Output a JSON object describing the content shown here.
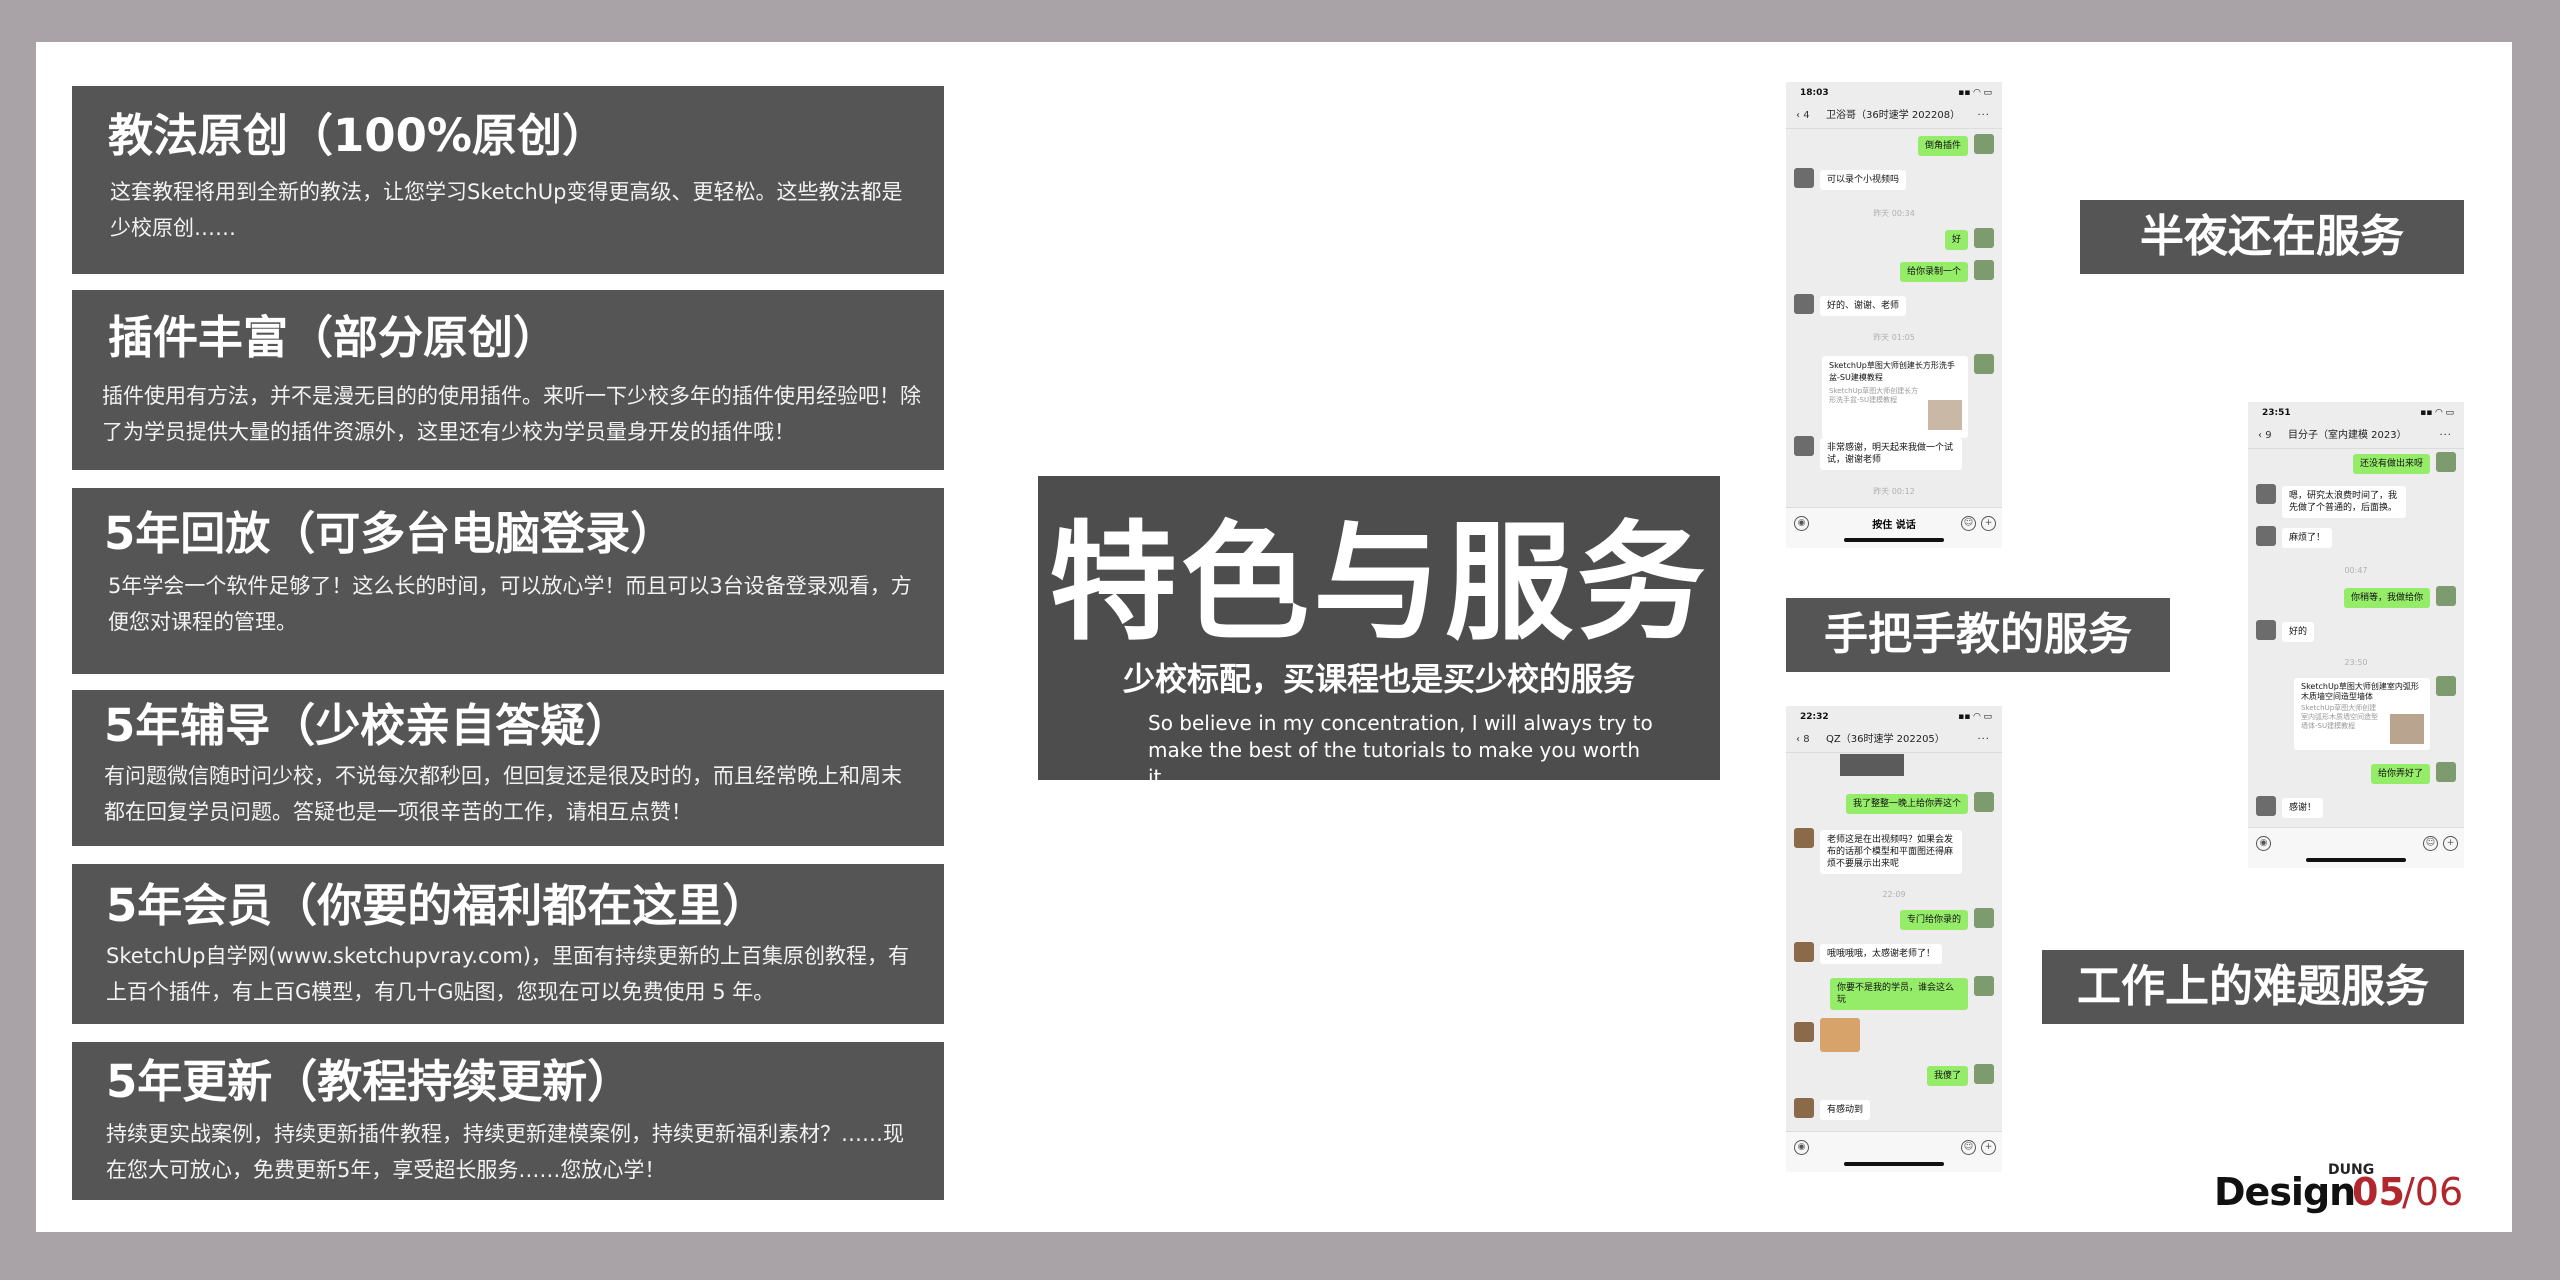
{
  "features": [
    {
      "title": "教法原创（100%原创）",
      "desc": "这套教程将用到全新的教法，让您学习SketchUp变得更高级、更轻松。这些教法都是少校原创……"
    },
    {
      "title": "插件丰富（部分原创）",
      "desc": "插件使用有方法，并不是漫无目的的使用插件。来听一下少校多年的插件使用经验吧！除了为学员提供大量的插件资源外，这里还有少校为学员量身开发的插件哦！"
    },
    {
      "title": "5年回放（可多台电脑登录）",
      "desc": "5年学会一个软件足够了！这么长的时间，可以放心学！而且可以3台设备登录观看，方便您对课程的管理。"
    },
    {
      "title": "5年辅导（少校亲自答疑）",
      "desc": "有问题微信随时问少校，不说每次都秒回，但回复还是很及时的，而且经常晚上和周末都在回复学员问题。答疑也是一项很辛苦的工作，请相互点赞！"
    },
    {
      "title": "5年会员（你要的福利都在这里）",
      "desc": "SketchUp自学网(www.sketchupvray.com)，里面有持续更新的上百集原创教程，有上百个插件，有上百G模型，有几十G贴图，您现在可以免费使用 5 年。"
    },
    {
      "title": "5年更新（教程持续更新）",
      "desc": "持续更实战案例，持续更新插件教程，持续更新建模案例，持续更新福利素材？……现在您大可放心，免费更新5年，享受超长服务……您放心学！"
    }
  ],
  "center": {
    "headline": "特色与服务",
    "subtitle": "少校标配，买课程也是买少校的服务",
    "english": "So believe in my concentration, I will always try to make the best of the tutorials to make you worth it."
  },
  "labels": {
    "midnight": "半夜还在服务",
    "handson": "手把手教的服务",
    "work": "工作上的难题服务"
  },
  "phone1": {
    "time": "18:03",
    "back_count": "4",
    "contact": "卫浴哥（36时速学 202208）",
    "messages": [
      "倒角插件",
      "可以录个小视频吗",
      "昨天 00:34",
      "好",
      "给你录制一个",
      "好的、谢谢、老师",
      "昨天 01:05",
      "SketchUp草图大师创建长方形洗手盆-SU建模教程",
      "SketchUp草图大师创建长方形洗手盆-SU建模教程",
      "非常感谢，明天起来我做一个试试，谢谢老师",
      "昨天 00:12"
    ],
    "hold_talk": "按住 说话"
  },
  "phone2": {
    "time": "23:51",
    "back_count": "9",
    "contact": "目分子（室内建模 2023）",
    "messages": [
      "还没有做出来呀",
      "嗯，研究太浪费时间了，我先做了个普通的，后面换。",
      "麻烦了！",
      "00:47",
      "你稍等，我做给你",
      "好的",
      "23:50",
      "SketchUp草图大师创建室内弧形木质墙空间造型墙体",
      "SketchUp草图大师创建室内弧形木质墙空间造型墙体-SU建模教程",
      "给你弄好了",
      "感谢！"
    ]
  },
  "phone3": {
    "time": "22:32",
    "back_count": "8",
    "contact": "QZ（36时速学 202205）",
    "messages": [
      "我了整整一晚上给你弄这个",
      "老师这是在出视频吗？如果会发布的话那个模型和平面图还得麻烦不要展示出来呢",
      "22:09",
      "专门给你录的",
      "哦哦哦哦，太感谢老师了！",
      "你要不是我的学员，谁会这么玩",
      "我傻了",
      "有感动到"
    ]
  },
  "logo": {
    "brand_small": "DUNG",
    "brand": "Design",
    "page": "05",
    "total": "/06"
  },
  "colors": {
    "card_bg": "#555555",
    "outer_bg": "#a9a2a6",
    "wechat_green": "#95ec69",
    "accent_red": "#b0282e"
  }
}
